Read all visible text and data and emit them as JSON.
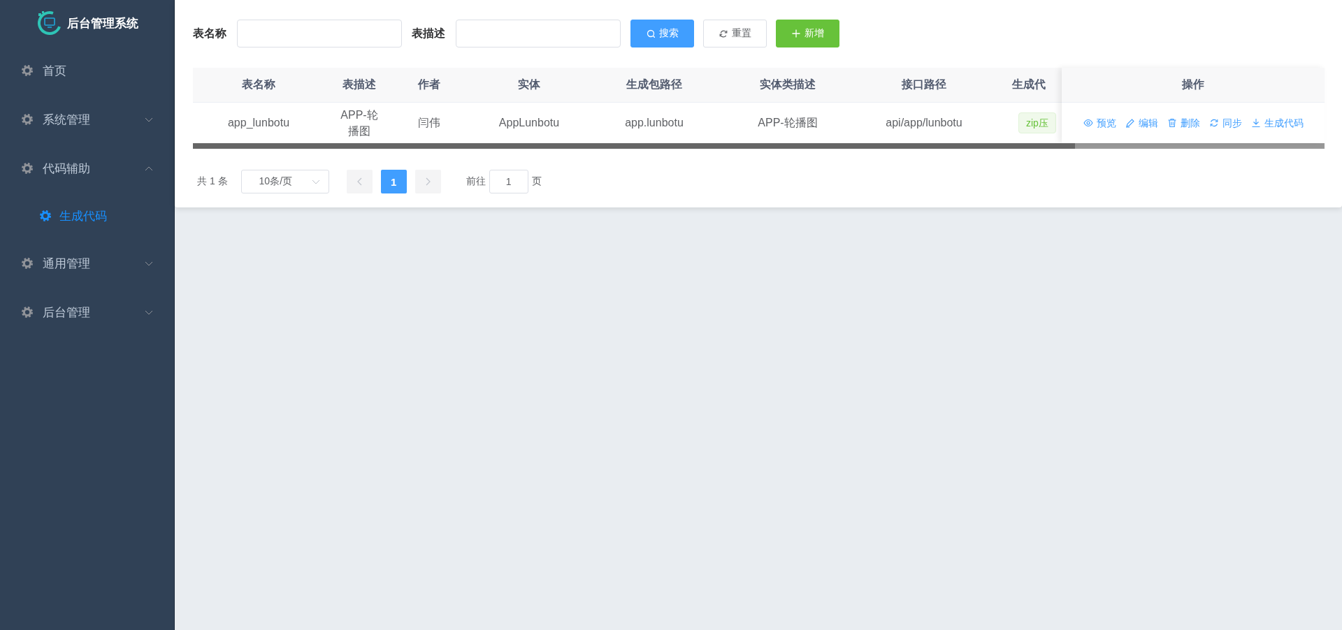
{
  "sidebar": {
    "logo_title": "后台管理系统",
    "items": [
      {
        "label": "首页",
        "kind": "link",
        "selected": false
      },
      {
        "label": "系统管理",
        "kind": "submenu",
        "expanded": false,
        "selected": false
      },
      {
        "label": "代码辅助",
        "kind": "submenu",
        "expanded": true,
        "selected": false,
        "children": [
          {
            "label": "生成代码",
            "selected": true
          }
        ]
      },
      {
        "label": "通用管理",
        "kind": "submenu",
        "expanded": false,
        "selected": false
      },
      {
        "label": "后台管理",
        "kind": "submenu",
        "expanded": false,
        "selected": false
      }
    ]
  },
  "filters": [
    {
      "label": "表名称"
    },
    {
      "label": "表描述"
    }
  ],
  "buttons": [
    {
      "label": "搜索",
      "kind": "primary"
    },
    {
      "label": "重置",
      "kind": "default"
    },
    {
      "label": "新增",
      "kind": "success"
    }
  ],
  "table": {
    "columns": [
      "表名称",
      "表描述",
      "作者",
      "实体",
      "生成包路径",
      "实体类描述",
      "接口路径",
      "生成代"
    ],
    "fixed_column": "操作",
    "rows": [
      {
        "cells": [
          "app_lunbotu",
          "APP-轮播图",
          "闫伟",
          "AppLunbotu",
          "app.lunbotu",
          "APP-轮播图",
          "api/app/lunbotu"
        ],
        "tag": "zip压",
        "actions": [
          "预览",
          "编辑",
          "删除",
          "同步",
          "生成代码"
        ]
      }
    ]
  },
  "pagination": {
    "total": "共 1 条",
    "page_size": "10条/页",
    "pages": [
      {
        "label": "1",
        "selected": true
      }
    ],
    "goto_label": "前往",
    "goto_value": "1",
    "goto_suffix": "页"
  }
}
